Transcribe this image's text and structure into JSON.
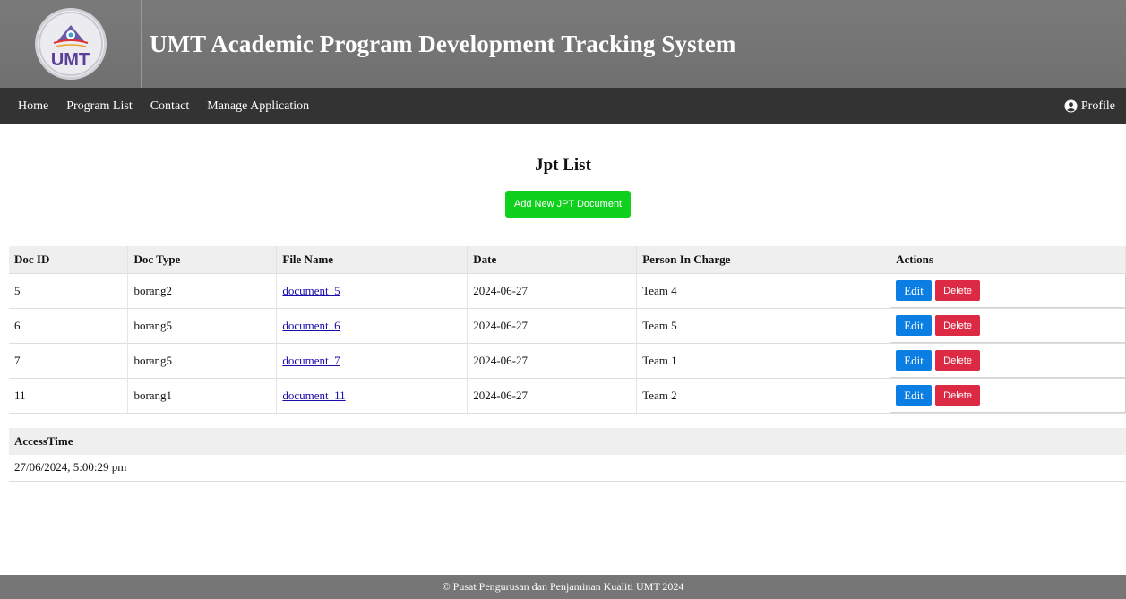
{
  "header": {
    "logo_text": "UMT",
    "title": "UMT Academic Program Development Tracking System"
  },
  "nav": {
    "items": [
      {
        "label": "Home"
      },
      {
        "label": "Program List"
      },
      {
        "label": "Contact"
      },
      {
        "label": "Manage Application"
      }
    ],
    "profile_label": "Profile",
    "profile_icon": "user-circle-icon"
  },
  "main": {
    "title": "Jpt List",
    "add_button_label": "Add New JPT Document",
    "table": {
      "columns": [
        "Doc ID",
        "Doc Type",
        "File Name",
        "Date",
        "Person In Charge",
        "Actions"
      ],
      "rows": [
        {
          "id": "5",
          "type": "borang2",
          "file": "document_5",
          "date": "2024-06-27",
          "person": "Team 4"
        },
        {
          "id": "6",
          "type": "borang5",
          "file": "document_6",
          "date": "2024-06-27",
          "person": "Team 5"
        },
        {
          "id": "7",
          "type": "borang5",
          "file": "document_7",
          "date": "2024-06-27",
          "person": "Team 1"
        },
        {
          "id": "11",
          "type": "borang1",
          "file": "document_11",
          "date": "2024-06-27",
          "person": "Team 2"
        }
      ],
      "edit_label": "Edit",
      "delete_label": "Delete"
    },
    "access": {
      "header": "AccessTime",
      "value": "27/06/2024, 5:00:29 pm"
    }
  },
  "footer": {
    "text": "© Pusat Pengurusan dan Penjaminan Kualiti UMT 2024"
  },
  "colors": {
    "header_bg": "#757575",
    "nav_bg": "#333333",
    "add_button": "#0fd01c",
    "edit_button": "#0b7ee3",
    "delete_button": "#dc2a44",
    "link": "#1a0dab"
  }
}
